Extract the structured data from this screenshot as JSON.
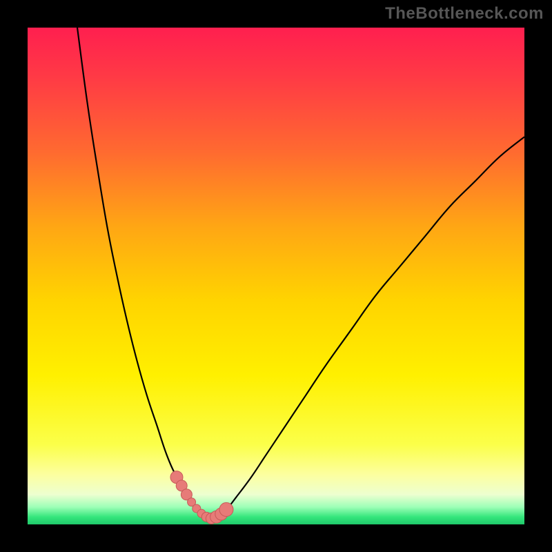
{
  "watermark": "TheBottleneck.com",
  "colors": {
    "frame": "#000000",
    "curve": "#000000",
    "marker": "#e77b78",
    "marker_stroke": "#c65a58",
    "gradient_stops": [
      {
        "offset": 0.0,
        "color": "#ff1f4f"
      },
      {
        "offset": 0.1,
        "color": "#ff3a45"
      },
      {
        "offset": 0.25,
        "color": "#ff6a30"
      },
      {
        "offset": 0.4,
        "color": "#ffa614"
      },
      {
        "offset": 0.55,
        "color": "#ffd400"
      },
      {
        "offset": 0.7,
        "color": "#fff000"
      },
      {
        "offset": 0.84,
        "color": "#fbff4a"
      },
      {
        "offset": 0.9,
        "color": "#fcffa0"
      },
      {
        "offset": 0.94,
        "color": "#edffd0"
      },
      {
        "offset": 0.965,
        "color": "#9dffb7"
      },
      {
        "offset": 0.985,
        "color": "#35e67c"
      },
      {
        "offset": 1.0,
        "color": "#1fc96a"
      }
    ]
  },
  "chart_data": {
    "type": "line",
    "title": "",
    "xlabel": "",
    "ylabel": "",
    "xlim": [
      0,
      100
    ],
    "ylim": [
      0,
      100
    ],
    "series": [
      {
        "name": "bottleneck-curve",
        "x": [
          10,
          12,
          14,
          16,
          18,
          20,
          22,
          24,
          26,
          28,
          30,
          32,
          33,
          34,
          35,
          36,
          37,
          38,
          40,
          42,
          45,
          48,
          52,
          56,
          60,
          65,
          70,
          75,
          80,
          85,
          90,
          95,
          100
        ],
        "y": [
          100,
          85,
          72,
          60,
          50,
          41,
          33,
          26,
          20,
          14,
          9.5,
          6,
          4.5,
          3.2,
          2.2,
          1.5,
          1.2,
          1.5,
          3,
          5.5,
          9.5,
          14,
          20,
          26,
          32,
          39,
          46,
          52,
          58,
          64,
          69,
          74,
          78
        ]
      }
    ],
    "markers": {
      "name": "highlight-points",
      "x": [
        30,
        31,
        32,
        33,
        34,
        35,
        36,
        37,
        38,
        39,
        40
      ],
      "y": [
        9.5,
        7.8,
        6,
        4.5,
        3.2,
        2.2,
        1.5,
        1.2,
        1.5,
        2.1,
        3
      ],
      "r": [
        9,
        8,
        8,
        6,
        6,
        6,
        7,
        8,
        9,
        9,
        10
      ]
    }
  }
}
